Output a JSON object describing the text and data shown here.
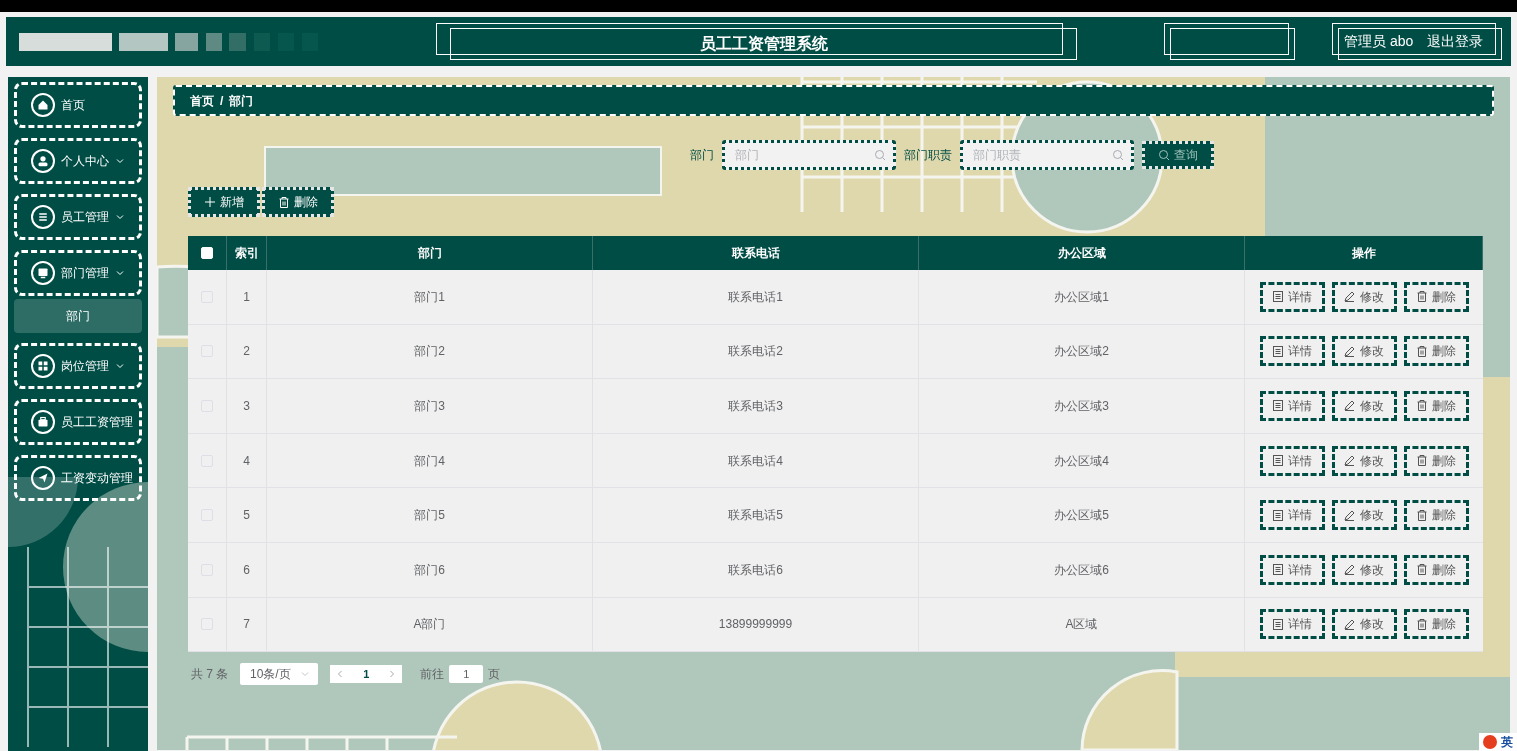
{
  "header": {
    "title": "员工工资管理系统",
    "user": "管理员 abo",
    "logout": "退出登录"
  },
  "sidebar": {
    "items": [
      {
        "label": "首页",
        "caret": false
      },
      {
        "label": "个人中心",
        "caret": true
      },
      {
        "label": "员工管理",
        "caret": true
      },
      {
        "label": "部门管理",
        "caret": true,
        "children": [
          {
            "label": "部门",
            "selected": true
          }
        ]
      },
      {
        "label": "岗位管理",
        "caret": true
      },
      {
        "label": "员工工资管理",
        "caret": false
      },
      {
        "label": "工资变动管理",
        "caret": false
      }
    ]
  },
  "breadcrumb": {
    "items": [
      "首页",
      "部门"
    ],
    "separator": "/"
  },
  "search": {
    "fields": [
      {
        "label": "部门",
        "placeholder": "部门"
      },
      {
        "label": "部门职责",
        "placeholder": "部门职责"
      }
    ],
    "button": "查询"
  },
  "actions": [
    "新增",
    "删除"
  ],
  "table": {
    "all_selected": false,
    "columns": [
      "索引",
      "部门",
      "联系电话",
      "办公区域",
      "操作"
    ],
    "rows": [
      {
        "selected": false,
        "cells": [
          "1",
          "部门1",
          "联系电话1",
          "办公区域1"
        ],
        "actions": [
          "详情",
          "修改",
          "删除"
        ]
      },
      {
        "selected": false,
        "cells": [
          "2",
          "部门2",
          "联系电话2",
          "办公区域2"
        ],
        "actions": [
          "详情",
          "修改",
          "删除"
        ]
      },
      {
        "selected": false,
        "cells": [
          "3",
          "部门3",
          "联系电话3",
          "办公区域3"
        ],
        "actions": [
          "详情",
          "修改",
          "删除"
        ]
      },
      {
        "selected": false,
        "cells": [
          "4",
          "部门4",
          "联系电话4",
          "办公区域4"
        ],
        "actions": [
          "详情",
          "修改",
          "删除"
        ]
      },
      {
        "selected": false,
        "cells": [
          "5",
          "部门5",
          "联系电话5",
          "办公区域5"
        ],
        "actions": [
          "详情",
          "修改",
          "删除"
        ]
      },
      {
        "selected": false,
        "cells": [
          "6",
          "部门6",
          "联系电话6",
          "办公区域6"
        ],
        "actions": [
          "详情",
          "修改",
          "删除"
        ]
      },
      {
        "selected": false,
        "cells": [
          "7",
          "A部门",
          "13899999999",
          "A区域"
        ],
        "actions": [
          "详情",
          "修改",
          "删除"
        ]
      }
    ]
  },
  "pagination": {
    "total": "共 7 条",
    "page_size": "10条/页",
    "current": "1",
    "goto_label": "前往",
    "goto_value": "1",
    "goto_suffix": "页"
  },
  "ime": {
    "label": "英"
  }
}
